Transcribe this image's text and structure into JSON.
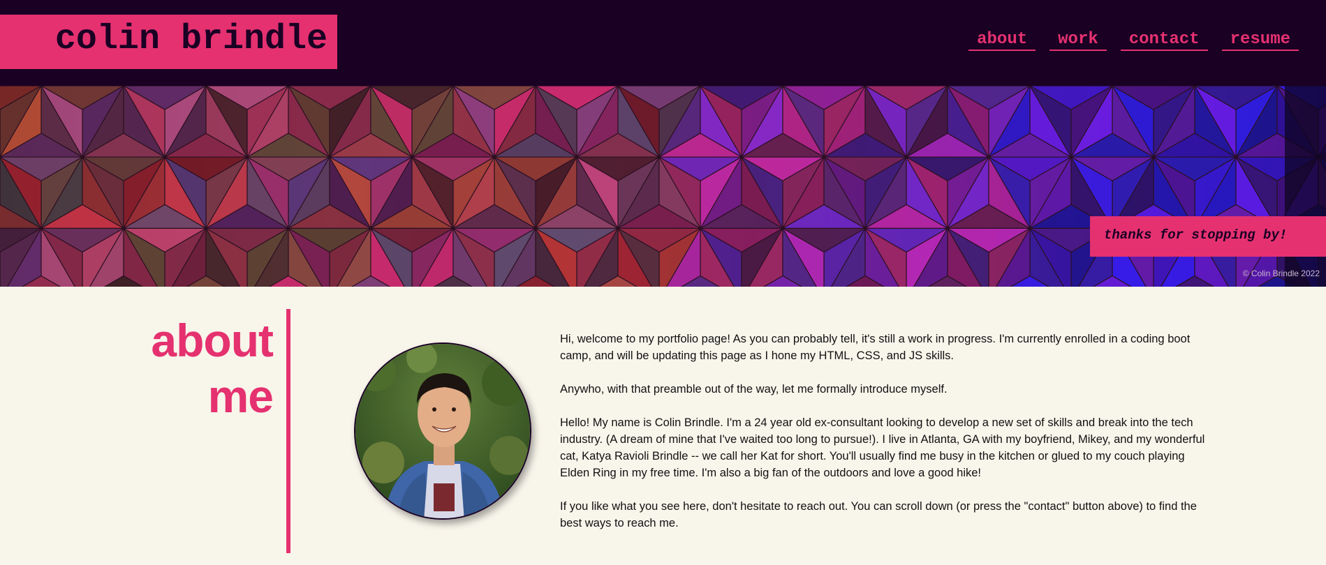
{
  "header": {
    "logo_text": "colin brindle",
    "nav": [
      {
        "label": "about"
      },
      {
        "label": "work"
      },
      {
        "label": "contact"
      },
      {
        "label": "resume"
      }
    ]
  },
  "hero": {
    "tagline": "thanks for stopping by!",
    "copyright": "© Colin Brindle 2022"
  },
  "about": {
    "heading_line1": "about",
    "heading_line2": "me",
    "paragraphs": [
      "Hi, welcome to my portfolio page! As you can probably tell, it's still a work in progress. I'm currently enrolled in a coding boot camp, and will be updating this page as I hone my HTML, CSS, and JS skills.",
      "Anywho, with that preamble out of the way, let me formally introduce myself.",
      "Hello! My name is Colin Brindle. I'm a 24 year old ex-consultant looking to develop a new set of skills and break into the tech industry. (A dream of mine that I've waited too long to pursue!). I live in Atlanta, GA with my boyfriend, Mikey, and my wonderful cat, Katya Ravioli Brindle -- we call her Kat for short. You'll usually find me busy in the kitchen or glued to my couch playing Elden Ring in my free time. I'm also a big fan of the outdoors and love a good hike!",
      "If you like what you see here, don't hesitate to reach out. You can scroll down (or press the \"contact\" button above) to find the best ways to reach me."
    ]
  },
  "colors": {
    "header_bg": "#1a0124",
    "accent": "#e53170",
    "page_bg": "#f8f5eb"
  }
}
